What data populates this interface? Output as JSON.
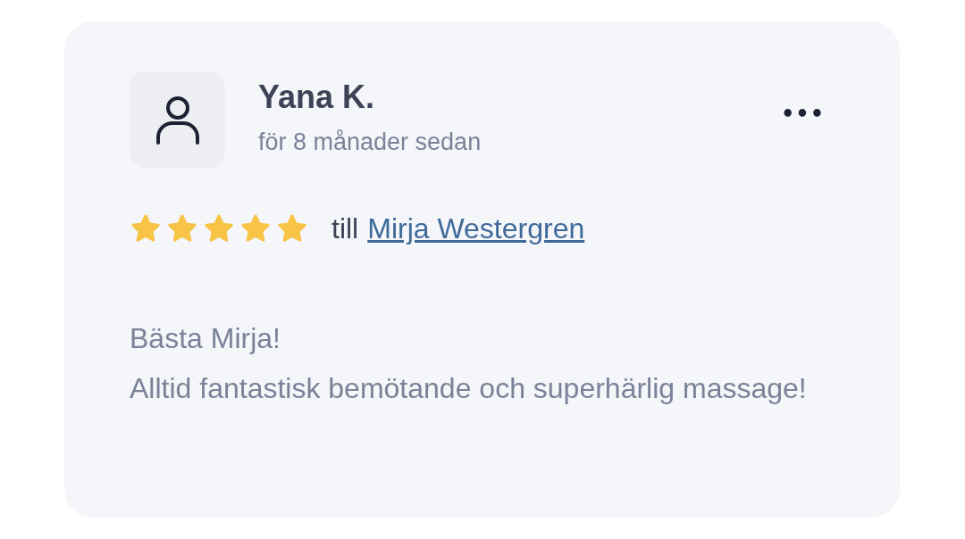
{
  "review": {
    "author": "Yana K.",
    "time": "för 8 månader sedan",
    "menu": "•••",
    "stars": 5,
    "recipient_prefix": "till",
    "recipient": "Mirja Westergren",
    "body": [
      "Bästa Mirja!",
      "Alltid fantastisk bemötande och superhärlig massage!"
    ]
  }
}
